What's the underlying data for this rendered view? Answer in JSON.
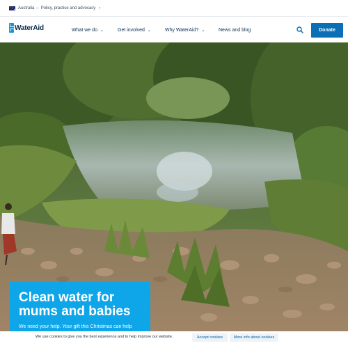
{
  "utility_bar": {
    "country": "Australia",
    "separator": "–",
    "link": "Policy, practice and advocacy",
    "chevron": "›"
  },
  "header": {
    "logo_text": "WaterAid",
    "nav": [
      {
        "label": "What we do",
        "has_dropdown": true
      },
      {
        "label": "Get involved",
        "has_dropdown": true
      },
      {
        "label": "Why WaterAid?",
        "has_dropdown": true
      },
      {
        "label": "News and blog",
        "has_dropdown": false
      }
    ],
    "search_icon": "search-icon",
    "donate_label": "Donate"
  },
  "hero": {
    "title": "Clean water for mums and babies",
    "subtitle": "We need your help. Your gift this Christmas can help"
  },
  "cookie_bar": {
    "message": "We use cookies to give you the best experience and to help improve our website.",
    "accept_label": "Accept cookies",
    "more_info_label": "More info about cookies"
  },
  "colors": {
    "brand_blue": "#0a6fb4",
    "hero_card": "#0ea5e9",
    "nav_text": "#0a2d4d"
  }
}
